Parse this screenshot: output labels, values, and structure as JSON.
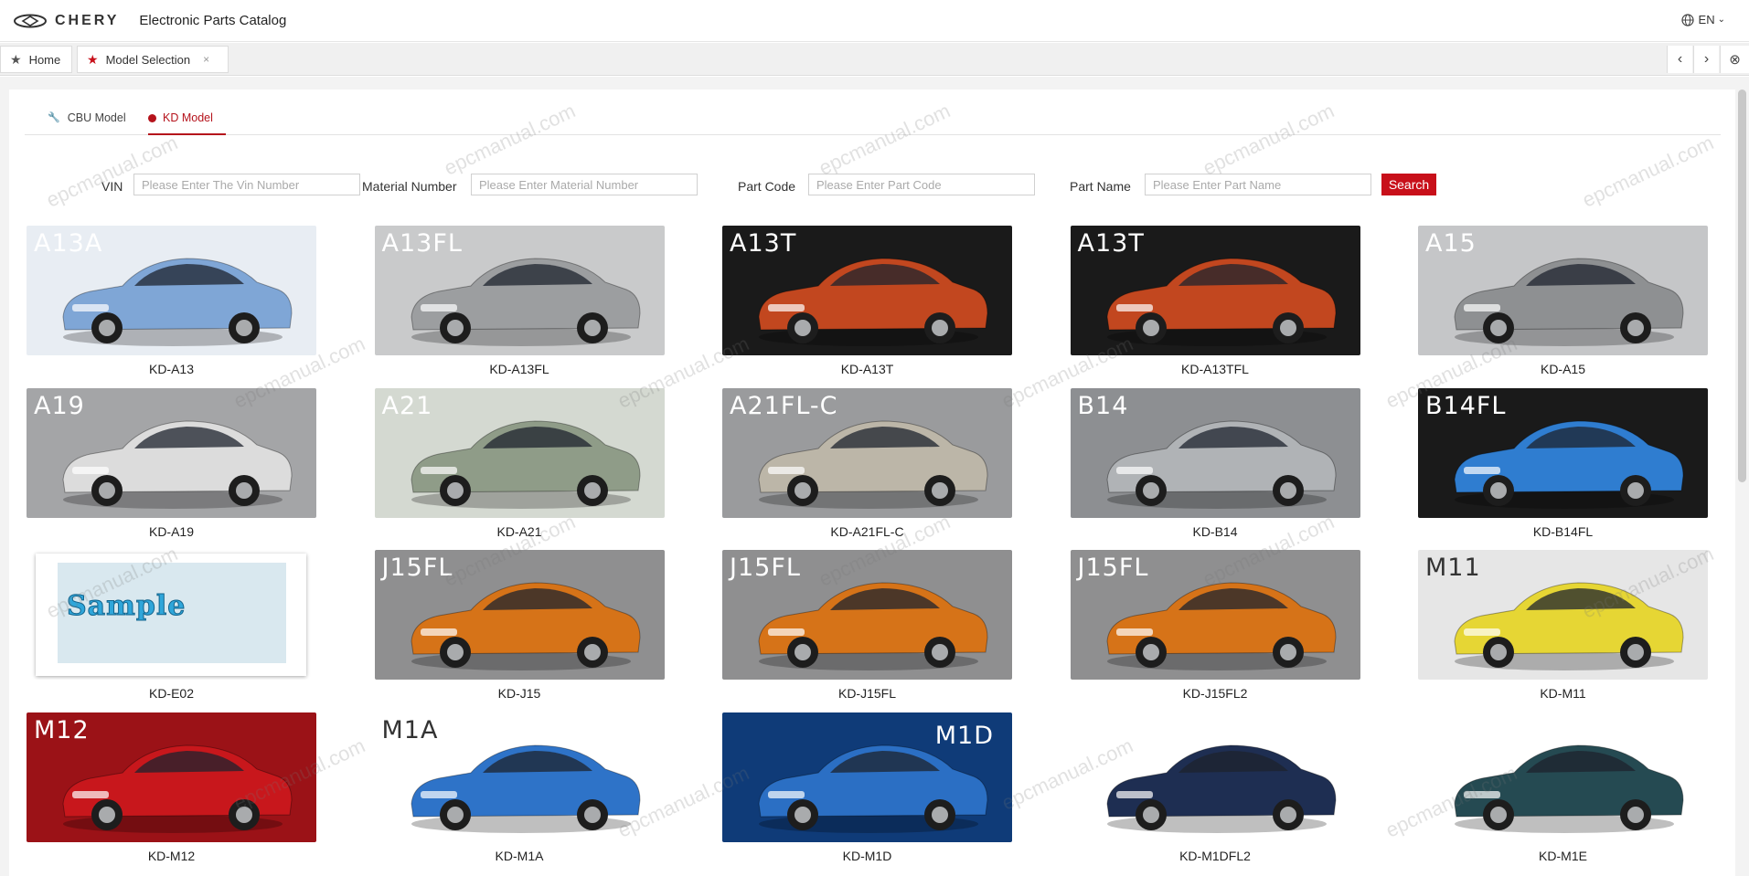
{
  "header": {
    "brand": "CHERY",
    "app_title": "Electronic Parts Catalog",
    "language": "EN"
  },
  "tabs": [
    {
      "label": "Home",
      "icon": "star-icon"
    },
    {
      "label": "Model Selection",
      "icon": "star-icon",
      "close": "×"
    }
  ],
  "strip_controls": {
    "prev": "‹",
    "next": "›",
    "close_all": "⊗"
  },
  "model_tabs": [
    {
      "label": "CBU Model",
      "icon": "wrench-icon",
      "active": false
    },
    {
      "label": "KD Model",
      "icon": "dot-icon",
      "active": true
    }
  ],
  "search": {
    "vin_label": "VIN",
    "vin_placeholder": "Please Enter The Vin Number",
    "material_label": "Material Number",
    "material_placeholder": "Please Enter Material Number",
    "part_code_label": "Part Code",
    "part_code_placeholder": "Please Enter Part Code",
    "part_name_label": "Part Name",
    "part_name_placeholder": "Please Enter Part Name",
    "search_button": "Search"
  },
  "models": [
    {
      "label": "KD-A13",
      "badge": "A13A",
      "color": "#7fa6d6",
      "bg": "#e8edf3"
    },
    {
      "label": "KD-A13FL",
      "badge": "A13FL",
      "color": "#9c9ea0",
      "bg": "#c9cacb"
    },
    {
      "label": "KD-A13T",
      "badge": "A13T",
      "color": "#c2471f",
      "bg": "#1a1a1a"
    },
    {
      "label": "KD-A13TFL",
      "badge": "A13T",
      "color": "#c2471f",
      "bg": "#1a1a1a"
    },
    {
      "label": "KD-A15",
      "badge": "A15",
      "color": "#8e9092",
      "bg": "#c5c6c8"
    },
    {
      "label": "KD-A19",
      "badge": "A19",
      "color": "#dcdcdc",
      "bg": "#a4a5a7"
    },
    {
      "label": "KD-A21",
      "badge": "A21",
      "color": "#8f9c88",
      "bg": "#d4d9d1"
    },
    {
      "label": "KD-A21FL-C",
      "badge": "A21FL-C",
      "color": "#bcb6a8",
      "bg": "#9a9b9d"
    },
    {
      "label": "KD-B14",
      "badge": "B14",
      "color": "#b0b3b6",
      "bg": "#8d8f92"
    },
    {
      "label": "KD-B14FL",
      "badge": "B14FL",
      "color": "#2f7dd0",
      "bg": "#1a1a1a"
    },
    {
      "label": "KD-E02",
      "badge": "",
      "sample_text": "Sample",
      "color": "#2fa6da",
      "bg": "#ffffff"
    },
    {
      "label": "KD-J15",
      "badge": "J15FL",
      "color": "#d67318",
      "bg": "#8f8f90"
    },
    {
      "label": "KD-J15FL",
      "badge": "J15FL",
      "color": "#d67318",
      "bg": "#8f8f90"
    },
    {
      "label": "KD-J15FL2",
      "badge": "J15FL",
      "color": "#d67318",
      "bg": "#8f8f90"
    },
    {
      "label": "KD-M11",
      "badge": "M11",
      "color": "#e6d634",
      "bg": "#e6e6e6"
    },
    {
      "label": "KD-M12",
      "badge": "M12",
      "color": "#c8171c",
      "bg": "#9b1217"
    },
    {
      "label": "KD-M1A",
      "badge": "M1A",
      "color": "#2e73c8",
      "bg": "#ffffff"
    },
    {
      "label": "KD-M1D",
      "badge": "M1D",
      "color": "#2b6fc4",
      "bg": "#0f3b78"
    },
    {
      "label": "KD-M1DFL2",
      "badge": "",
      "color": "#1e2e52",
      "bg": "#ffffff"
    },
    {
      "label": "KD-M1E",
      "badge": "",
      "color": "#254a52",
      "bg": "#ffffff"
    }
  ],
  "watermark_text": "epcmanual.com"
}
